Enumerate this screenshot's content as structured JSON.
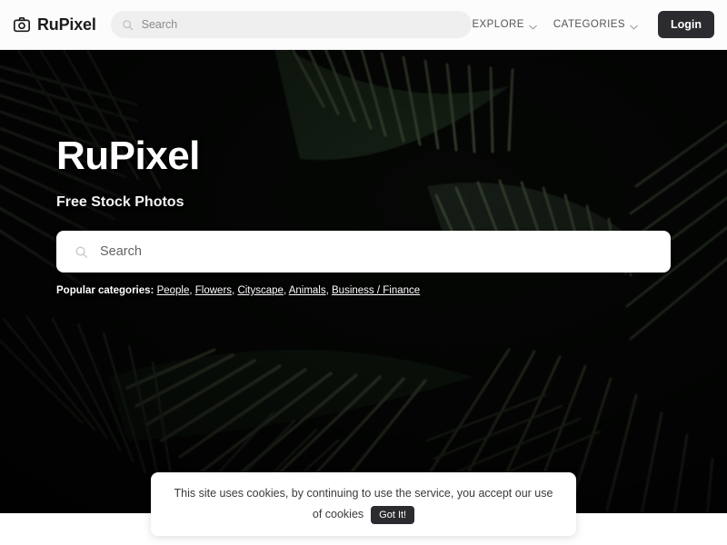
{
  "header": {
    "logo": {
      "icon": "camera-icon",
      "text": "RuPixel"
    },
    "search": {
      "placeholder": "Search",
      "value": "",
      "icon": "search-icon"
    },
    "nav": [
      {
        "label": "EXPLORE",
        "icon": "chevron-down-icon"
      },
      {
        "label": "CATEGORIES",
        "icon": "chevron-down-icon"
      }
    ],
    "login_label": "Login"
  },
  "hero": {
    "title": "RuPixel",
    "subtitle": "Free Stock Photos",
    "search": {
      "placeholder": "Search",
      "value": "",
      "icon": "search-icon"
    },
    "popular_label": "Popular categories:",
    "categories": [
      "People",
      "Flowers",
      "Cityscape",
      "Animals",
      "Business / Finance"
    ],
    "separator": ", "
  },
  "cookie": {
    "message": "This site uses cookies, by continuing to use the service, you accept our use of cookies",
    "button_label": "Got It!"
  },
  "colors": {
    "header_bg": "#fcfcfc",
    "header_search_bg": "#efefef",
    "accent_dark": "#2b2b30",
    "hero_bg": "#060806",
    "text_light": "#ffffff",
    "nav_text": "#55555a"
  }
}
